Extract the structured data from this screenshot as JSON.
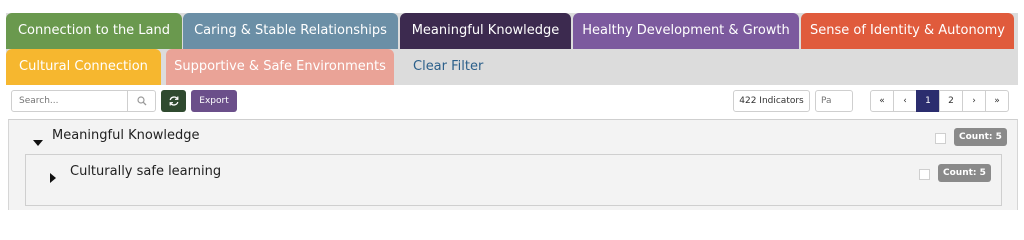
{
  "tabs": [
    {
      "label": "Connection to the Land",
      "color": "#6a994e"
    },
    {
      "label": "Caring & Stable Relationships",
      "color": "#6b8fa6"
    },
    {
      "label": "Meaningful Knowledge",
      "color": "#3c2a4f"
    },
    {
      "label": "Healthy Development & Growth",
      "color": "#7c5a9e"
    },
    {
      "label": "Sense of Identity & Autonomy",
      "color": "#e05b3c"
    },
    {
      "label": "Cultural Connection",
      "color": "#f6b72f"
    },
    {
      "label": "Supportive & Safe Environments",
      "color": "#eaa397"
    }
  ],
  "clear_filter_label": "Clear Filter",
  "toolbar": {
    "search_placeholder": "Search...",
    "search_icon": "magnifier-icon",
    "refresh_icon": "refresh-icon",
    "export_label": "Export",
    "indicator_count": "422 Indicators",
    "page_input_placeholder": "Pa"
  },
  "pagination": {
    "first": "«",
    "prev": "‹",
    "pages": [
      "1",
      "2"
    ],
    "current": "1",
    "next": "›",
    "last": "»"
  },
  "groups": [
    {
      "title": "Meaningful Knowledge",
      "count": "Count: 5",
      "subgroups": [
        {
          "title": "Culturally safe learning",
          "count": "Count: 5"
        }
      ]
    }
  ]
}
